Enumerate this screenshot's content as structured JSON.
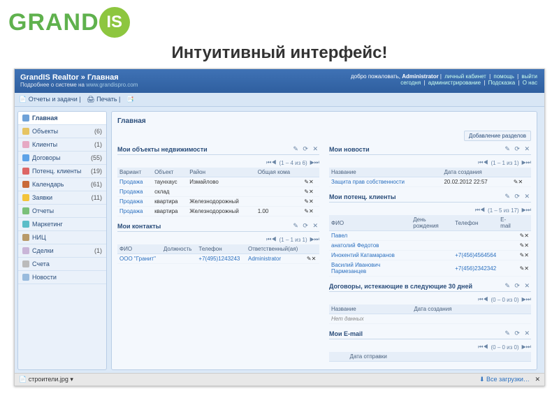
{
  "logo": {
    "left": "GRAND",
    "right": "IS"
  },
  "slogan": "Интуитивный интерфейс!",
  "app": {
    "title": "GrandIS Realtor » Главная",
    "subtitle_prefix": "Подробнее о системе на ",
    "subtitle_link": "www.grandispro.com",
    "welcome_prefix": "добро пожаловать, ",
    "welcome_user": "Administrator",
    "links": {
      "cabinet": "личный кабинет",
      "help": "помощь",
      "logout": "выйти"
    },
    "links2": {
      "today": "сегодня",
      "admin": "администрирование",
      "support": "Подсказка",
      "about": "О нас"
    }
  },
  "toolbar": {
    "reports": "Отчеты и задачи",
    "print": "Печать"
  },
  "sidebar": [
    {
      "label": "Главная",
      "count": ""
    },
    {
      "label": "Объекты",
      "count": "(6)"
    },
    {
      "label": "Клиенты",
      "count": "(1)"
    },
    {
      "label": "Договоры",
      "count": "(55)"
    },
    {
      "label": "Потенц. клиенты",
      "count": "(19)"
    },
    {
      "label": "Календарь",
      "count": "(61)"
    },
    {
      "label": "Заявки",
      "count": "(11)"
    },
    {
      "label": "Отчеты",
      "count": ""
    },
    {
      "label": "Маркетинг",
      "count": ""
    },
    {
      "label": "НИЦ",
      "count": ""
    },
    {
      "label": "Сделки",
      "count": "(1)"
    },
    {
      "label": "Счета",
      "count": ""
    },
    {
      "label": "Новости",
      "count": ""
    }
  ],
  "crumb": "Главная",
  "addSections": "Добавление разделов",
  "left": {
    "p1": {
      "title": "Мои объекты недвижимости",
      "tools": "✎ ⟳ ✕",
      "pager": "(1 – 4 из 6)",
      "cols": {
        "c1": "Вариант",
        "c2": "Объект",
        "c3": "Район",
        "c4": "Общая кома"
      },
      "rows": [
        {
          "c1": "Продажа",
          "c2": "таунхаус",
          "c3": "Измайлово",
          "c4": ""
        },
        {
          "c1": "Продажа",
          "c2": "склад",
          "c3": "",
          "c4": ""
        },
        {
          "c1": "Продажа",
          "c2": "квартира",
          "c3": "Железнодорожный",
          "c4": ""
        },
        {
          "c1": "Продажа",
          "c2": "квартира",
          "c3": "Железнодорожный",
          "c4": "1.00"
        }
      ]
    },
    "p2": {
      "title": "Мои контакты",
      "tools": "✎ ⟳ ✕",
      "pager": "(1 – 1 из 1)",
      "cols": {
        "c1": "ФИО",
        "c2": "Должность",
        "c3": "Телефон",
        "c4": "Ответственный(ая)"
      },
      "rows": [
        {
          "c1": "ООО \"Гранит\"",
          "c2": "",
          "c3": "+7(495)1243243",
          "c4": "Administrator"
        }
      ]
    }
  },
  "right": {
    "p1": {
      "title": "Мои новости",
      "tools": "✎ ⟳ ✕",
      "pager": "(1 – 1 из 1)",
      "cols": {
        "c1": "Название",
        "c2": "Дата создания"
      },
      "rows": [
        {
          "c1": "Защита прав собственности",
          "c2": "20.02.2012 22:57"
        }
      ]
    },
    "p2": {
      "title": "Мои потенц. клиенты",
      "tools": "✎ ⟳ ✕",
      "pager": "(1 – 5 из 17)",
      "cols": {
        "c1": "ФИО",
        "c2": "День рождения",
        "c3": "Телефон",
        "c4": "E-mail"
      },
      "rows": [
        {
          "c1": "Павел",
          "c3": ""
        },
        {
          "c1": "анатолий Федотов",
          "c3": ""
        },
        {
          "c1": "Инокентий Катамаранов",
          "c3": "+7(456)4564564"
        },
        {
          "c1": "Василий Иванович Пармезанцев",
          "c3": "+7(456)2342342"
        }
      ]
    },
    "p3": {
      "title": "Договоры, истекающие в следующие 30 дней",
      "tools": "✎ ⟳ ✕",
      "pager": "(0 – 0 из 0)",
      "cols": {
        "c1": "Название",
        "c2": "Дата создания"
      },
      "empty": "Нет данных"
    },
    "p4": {
      "title": "Мои E-mail",
      "tools": "✎ ⟳ ✕",
      "pager": "(0 – 0 из 0)",
      "cols": {
        "c2": "Дата отправки"
      }
    }
  },
  "bottom": {
    "file": "строители.jpg",
    "dl": "Все загрузки…"
  }
}
